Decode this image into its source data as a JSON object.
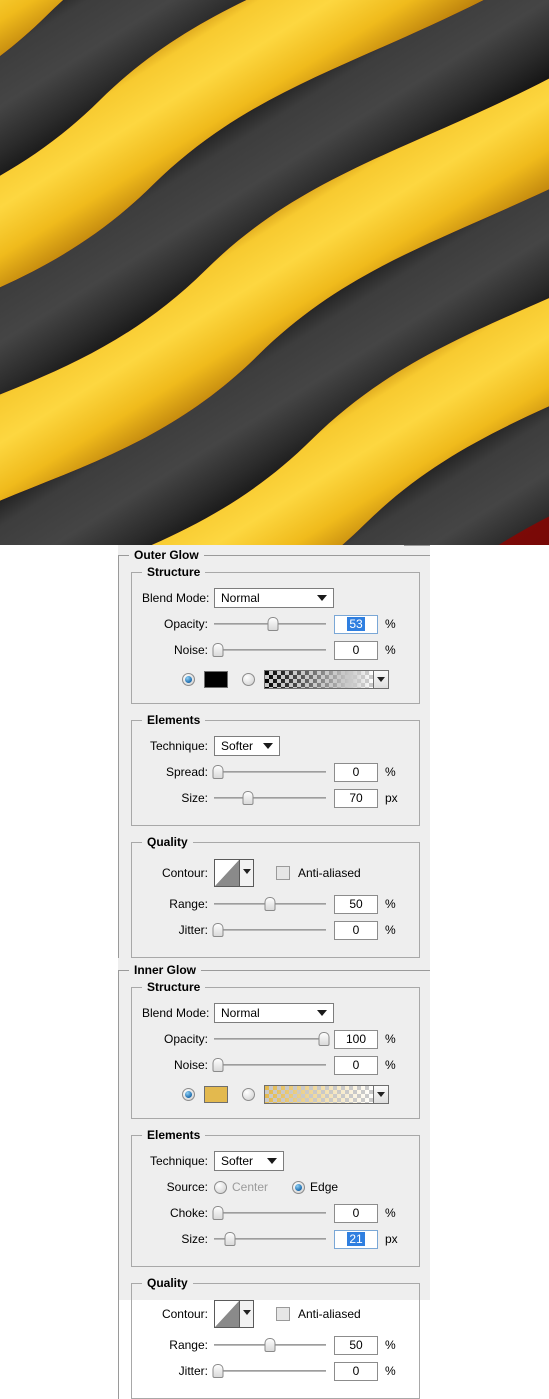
{
  "artwork": {
    "name": "caution-stripe-ribbon-artwork",
    "background_color": "#8e0d0a",
    "stripe_yellow": "#f5c322",
    "stripe_black": "#333333"
  },
  "panel": {
    "background_color": "#eeeeee",
    "accent_selection_color": "#2f7fe0",
    "sections": [
      {
        "id": "outer_glow",
        "title": "Outer Glow",
        "subsections": [
          {
            "id": "structure",
            "title": "Structure",
            "blend_mode_label": "Blend Mode:",
            "blend_mode_value": "Normal",
            "opacity_label": "Opacity:",
            "opacity_value": "53",
            "opacity_unit": "%",
            "opacity_selected": true,
            "noise_label": "Noise:",
            "noise_value": "0",
            "noise_unit": "%",
            "fill_type": "color",
            "color_swatch": "#000000",
            "gradient_from": "#000000",
            "gradient_to": "transparent"
          },
          {
            "id": "elements",
            "title": "Elements",
            "technique_label": "Technique:",
            "technique_value": "Softer",
            "spread_label": "Spread:",
            "spread_value": "0",
            "spread_unit": "%",
            "size_label": "Size:",
            "size_value": "70",
            "size_unit": "px"
          },
          {
            "id": "quality",
            "title": "Quality",
            "contour_label": "Contour:",
            "antialiased_label": "Anti-aliased",
            "antialiased_checked": false,
            "range_label": "Range:",
            "range_value": "50",
            "range_unit": "%",
            "jitter_label": "Jitter:",
            "jitter_value": "0",
            "jitter_unit": "%"
          }
        ]
      },
      {
        "id": "inner_glow",
        "title": "Inner Glow",
        "subsections": [
          {
            "id": "structure",
            "title": "Structure",
            "blend_mode_label": "Blend Mode:",
            "blend_mode_value": "Normal",
            "opacity_label": "Opacity:",
            "opacity_value": "100",
            "opacity_unit": "%",
            "opacity_selected": false,
            "noise_label": "Noise:",
            "noise_value": "0",
            "noise_unit": "%",
            "fill_type": "color",
            "color_swatch": "#e3b94e",
            "gradient_from": "#e3b94e",
            "gradient_to": "transparent"
          },
          {
            "id": "elements",
            "title": "Elements",
            "technique_label": "Technique:",
            "technique_value": "Softer",
            "source_label": "Source:",
            "source_center_label": "Center",
            "source_edge_label": "Edge",
            "source_selected": "Edge",
            "choke_label": "Choke:",
            "choke_value": "0",
            "choke_unit": "%",
            "size_label": "Size:",
            "size_value": "21",
            "size_unit": "px",
            "size_selected": true
          },
          {
            "id": "quality",
            "title": "Quality",
            "contour_label": "Contour:",
            "antialiased_label": "Anti-aliased",
            "antialiased_checked": false,
            "range_label": "Range:",
            "range_value": "50",
            "range_unit": "%",
            "jitter_label": "Jitter:",
            "jitter_value": "0",
            "jitter_unit": "%"
          }
        ]
      }
    ]
  }
}
